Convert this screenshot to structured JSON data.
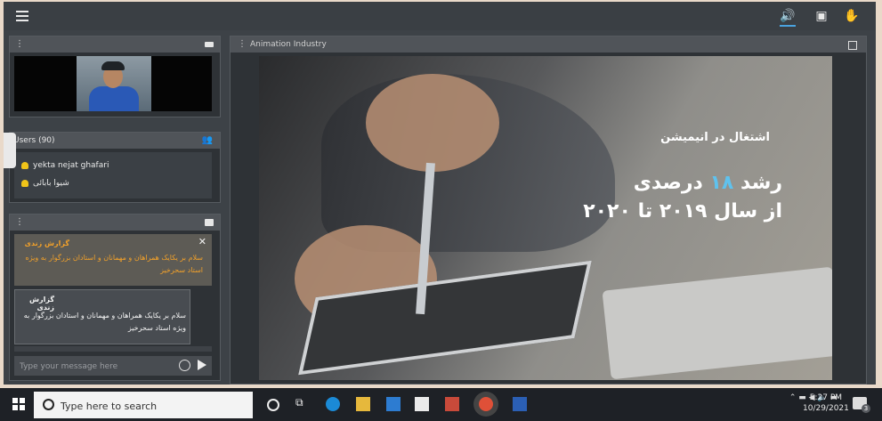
{
  "app": {
    "top_icons": [
      "menu-icon",
      "speaker-icon",
      "screen-share-icon",
      "hand-raise-icon"
    ]
  },
  "webcam_panel": {
    "icon": "camera-icon"
  },
  "users": {
    "title": "Users (90)",
    "items": [
      "yekta nejat ghafari",
      "شیوا بابائی"
    ]
  },
  "chat": {
    "notice_title": "گزارش زندی",
    "notice_text": "سلام بر یکایک همراهان و مهمانان و استادان بزرگوار به ویژه استاد سحرخیز",
    "message_title": "گزارش زندی",
    "message_text": "سلام بر یکایک همراهان و مهمانان و استادان بزرگوار به ویژه استاد سحرخیز",
    "input_placeholder": "Type your message here"
  },
  "presentation": {
    "title": "Animation Industry",
    "slide_line1": "اشتغال در انیمیشن",
    "slide_line2_prefix": "رشد ",
    "slide_line2_highlight": "۱۸",
    "slide_line2_suffix": " درصدی",
    "slide_line3": "از سال ۲۰۱۹ تا ۲۰۲۰",
    "highlight_color": "#5fc2ee"
  },
  "taskbar": {
    "search_placeholder": "Type here to search",
    "time": "5:27 PM",
    "date": "10/29/2021",
    "notification_count": "3"
  }
}
